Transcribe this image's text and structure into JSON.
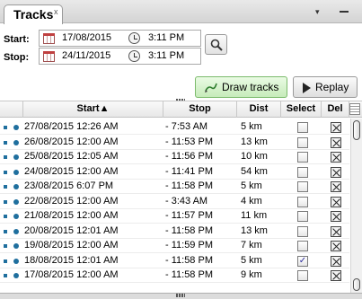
{
  "tab": {
    "label": "Tracks",
    "close_glyph": "x"
  },
  "panel_controls": {
    "menu_glyph": "▾",
    "minimize_icon": "minimize-icon"
  },
  "range": {
    "start_label": "Start:",
    "start_date": "17/08/2015",
    "start_time": "3:11 PM",
    "stop_label": "Stop:",
    "stop_date": "24/11/2015",
    "stop_time": "3:11 PM"
  },
  "icons": {
    "calendar": "calendar-icon",
    "clock": "clock-icon",
    "search": "search-icon",
    "play": "play-icon",
    "pen": "pen-icon"
  },
  "buttons": {
    "draw": "Draw tracks",
    "replay": "Replay"
  },
  "colors": {
    "accent": "#1f6f9e",
    "draw_button": "#c6ebba"
  },
  "grid": {
    "headers": {
      "start": "Start▲",
      "stop": "Stop",
      "dist": "Dist",
      "select": "Select",
      "del": "Del"
    },
    "rows": [
      {
        "start": "27/08/2015 12:26 AM",
        "stop": "- 7:53 AM",
        "dist": "5 km",
        "selected": false
      },
      {
        "start": "26/08/2015 12:00 AM",
        "stop": "- 11:53 PM",
        "dist": "13 km",
        "selected": false
      },
      {
        "start": "25/08/2015 12:05 AM",
        "stop": "- 11:56 PM",
        "dist": "10 km",
        "selected": false
      },
      {
        "start": "24/08/2015 12:00 AM",
        "stop": "- 11:41 PM",
        "dist": "54 km",
        "selected": false
      },
      {
        "start": "23/08/2015 6:07 PM",
        "stop": "- 11:58 PM",
        "dist": "5 km",
        "selected": false
      },
      {
        "start": "22/08/2015 12:00 AM",
        "stop": "- 3:43 AM",
        "dist": "4 km",
        "selected": false
      },
      {
        "start": "21/08/2015 12:00 AM",
        "stop": "- 11:57 PM",
        "dist": "11 km",
        "selected": false
      },
      {
        "start": "20/08/2015 12:01 AM",
        "stop": "- 11:58 PM",
        "dist": "13 km",
        "selected": false
      },
      {
        "start": "19/08/2015 12:00 AM",
        "stop": "- 11:59 PM",
        "dist": "7 km",
        "selected": false
      },
      {
        "start": "18/08/2015 12:01 AM",
        "stop": "- 11:58 PM",
        "dist": "5 km",
        "selected": true
      },
      {
        "start": "17/08/2015 12:00 AM",
        "stop": "- 11:58 PM",
        "dist": "9 km",
        "selected": false
      }
    ]
  }
}
